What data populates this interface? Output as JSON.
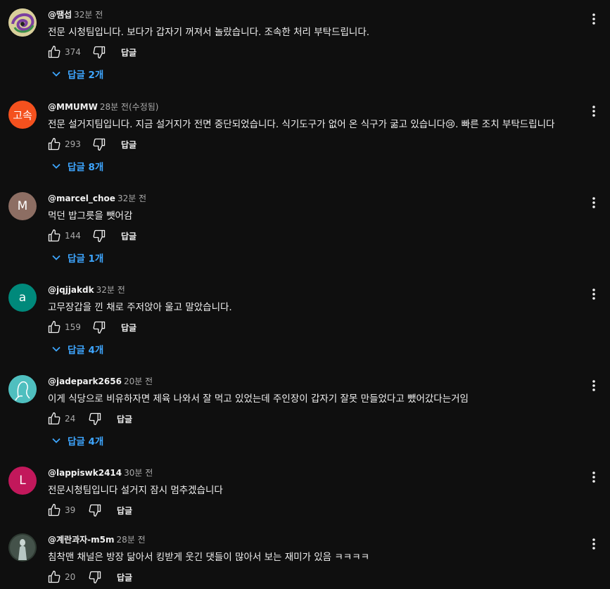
{
  "reply_label": "답글",
  "comments": [
    {
      "author": "@땜섭",
      "time": "32분 전",
      "text": "전문 시청팀입니다. 보다가 갑자기 꺼져서 놀랐습니다. 조속한 처리 부탁드립니다.",
      "likes": "374",
      "replies": "답글 2개",
      "avatar": {
        "kind": "image",
        "initial": "",
        "color": "#6b5b3e"
      }
    },
    {
      "author": "@MMUMW",
      "time": "28분 전(수정됨)",
      "text": "전문 설거지팀입니다. 지금 설거지가 전면 중단되었습니다. 식기도구가 없어 온 식구가 굶고 있습니다😢. 빠른 조치 부탁드립니다",
      "likes": "293",
      "replies": "답글 8개",
      "avatar": {
        "kind": "initial",
        "initial": "고속",
        "color": "#f4511e"
      }
    },
    {
      "author": "@marcel_choe",
      "time": "32분 전",
      "text": "먹던 밥그릇을 뺏어감",
      "likes": "144",
      "replies": "답글 1개",
      "avatar": {
        "kind": "initial",
        "initial": "M",
        "color": "#8d6e63"
      }
    },
    {
      "author": "@jqjjakdk",
      "time": "32분 전",
      "text": "고무장갑을 낀 채로 주저앉아 울고 말았습니다.",
      "likes": "159",
      "replies": "답글 4개",
      "avatar": {
        "kind": "initial",
        "initial": "a",
        "color": "#00897b"
      }
    },
    {
      "author": "@jadepark2656",
      "time": "20분 전",
      "text": "이게 식당으로 비유하자면 제육 나와서 잘 먹고 있었는데 주인장이 갑자기 잘못 만들었다고 뺐어갔다는거임",
      "likes": "24",
      "replies": "답글 4개",
      "avatar": {
        "kind": "image",
        "initial": "",
        "color": "#4fbfbf"
      }
    },
    {
      "author": "@lappiswk2414",
      "time": "30분 전",
      "text": "전문시청팀입니다 설거지 잠시 멈추겠습니다",
      "likes": "39",
      "replies": "",
      "avatar": {
        "kind": "initial",
        "initial": "L",
        "color": "#c2185b"
      }
    },
    {
      "author": "@계란과자-m5m",
      "time": "28분 전",
      "text": "침착맨 채널은 방장 닮아서 킹받게 웃긴 댓들이 많아서 보는 재미가 있음 ㅋㅋㅋㅋ",
      "likes": "20",
      "replies": "",
      "avatar": {
        "kind": "image",
        "initial": "",
        "color": "#2b3a2f"
      }
    }
  ]
}
